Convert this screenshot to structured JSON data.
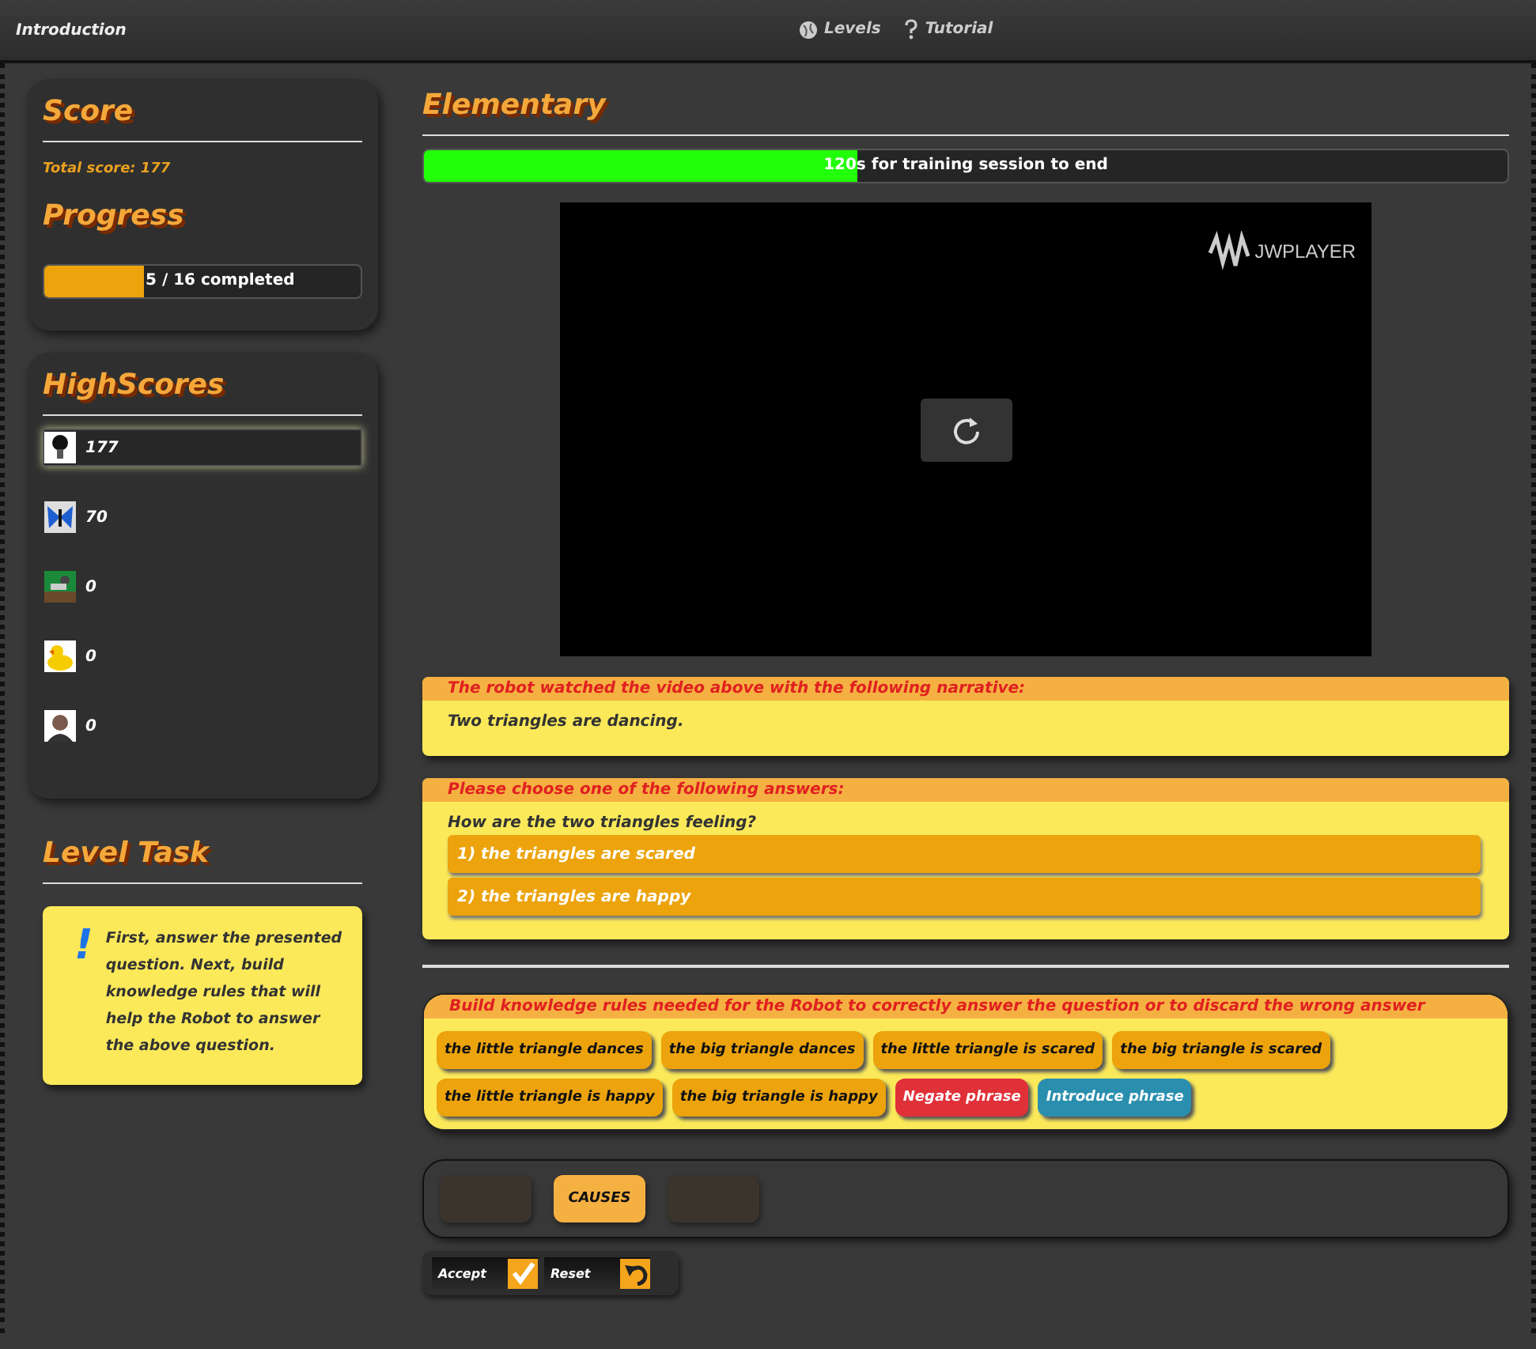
{
  "top_bar": {
    "title": "Introduction",
    "links": [
      {
        "kind": "levels",
        "label": "Levels"
      },
      {
        "kind": "tutorial",
        "label": "Tutorial"
      }
    ]
  },
  "score": {
    "heading": "Score",
    "total": "Total score: 177"
  },
  "progress": {
    "heading": "Progress",
    "label": "5 / 16 completed",
    "level": 0.3125
  },
  "highscores": {
    "heading": "HighScores",
    "items": [
      {
        "kind": "bulb",
        "score": "177",
        "selected": true
      },
      {
        "kind": "butterfly",
        "score": "70",
        "selected": false
      },
      {
        "kind": "picture",
        "score": "0",
        "selected": false
      },
      {
        "kind": "duck",
        "score": "0",
        "selected": false
      },
      {
        "kind": "person",
        "score": "0",
        "selected": false
      }
    ]
  },
  "level_task": {
    "heading": "Level Task",
    "mark": "!",
    "text": "First, answer the presented question. Next, build knowledge rules that will help the Robot to answer the above question."
  },
  "level": {
    "heading": "Elementary",
    "timer": {
      "label": "120s for training session to end",
      "level": 0.4
    }
  },
  "player": {
    "logo": "JWPLAYER"
  },
  "narrative": {
    "heading": "The robot watched the video above with the following narrative:",
    "text": "Two triangles are dancing."
  },
  "question": {
    "heading": "Please choose one of the following answers:",
    "text": "How are the two triangles feeling?",
    "answers": [
      {
        "label": "1) the triangles are scared",
        "selected": false
      },
      {
        "label": "2) the triangles are happy",
        "selected": false
      }
    ]
  },
  "rules": {
    "heading": "Build knowledge rules needed for the Robot to correctly answer the question or to discard the wrong answer",
    "phrases": [
      {
        "kind": "phrase",
        "label": "the little triangle dances"
      },
      {
        "kind": "phrase",
        "label": "the big triangle dances"
      },
      {
        "kind": "phrase",
        "label": "the little triangle is scared"
      },
      {
        "kind": "phrase",
        "label": "the big triangle is scared"
      },
      {
        "kind": "phrase",
        "label": "the little triangle is happy"
      },
      {
        "kind": "phrase",
        "label": "the big triangle is happy"
      },
      {
        "kind": "negate",
        "label": "Negate phrase"
      },
      {
        "kind": "introduce",
        "label": "Introduce phrase"
      }
    ]
  },
  "slots": [
    {
      "kind": "empty"
    },
    {
      "kind": "word",
      "label": "CAUSES"
    },
    {
      "kind": "empty"
    }
  ],
  "actions": [
    {
      "kind": "accept",
      "label": "Accept"
    },
    {
      "kind": "reset",
      "label": "Reset"
    }
  ]
}
